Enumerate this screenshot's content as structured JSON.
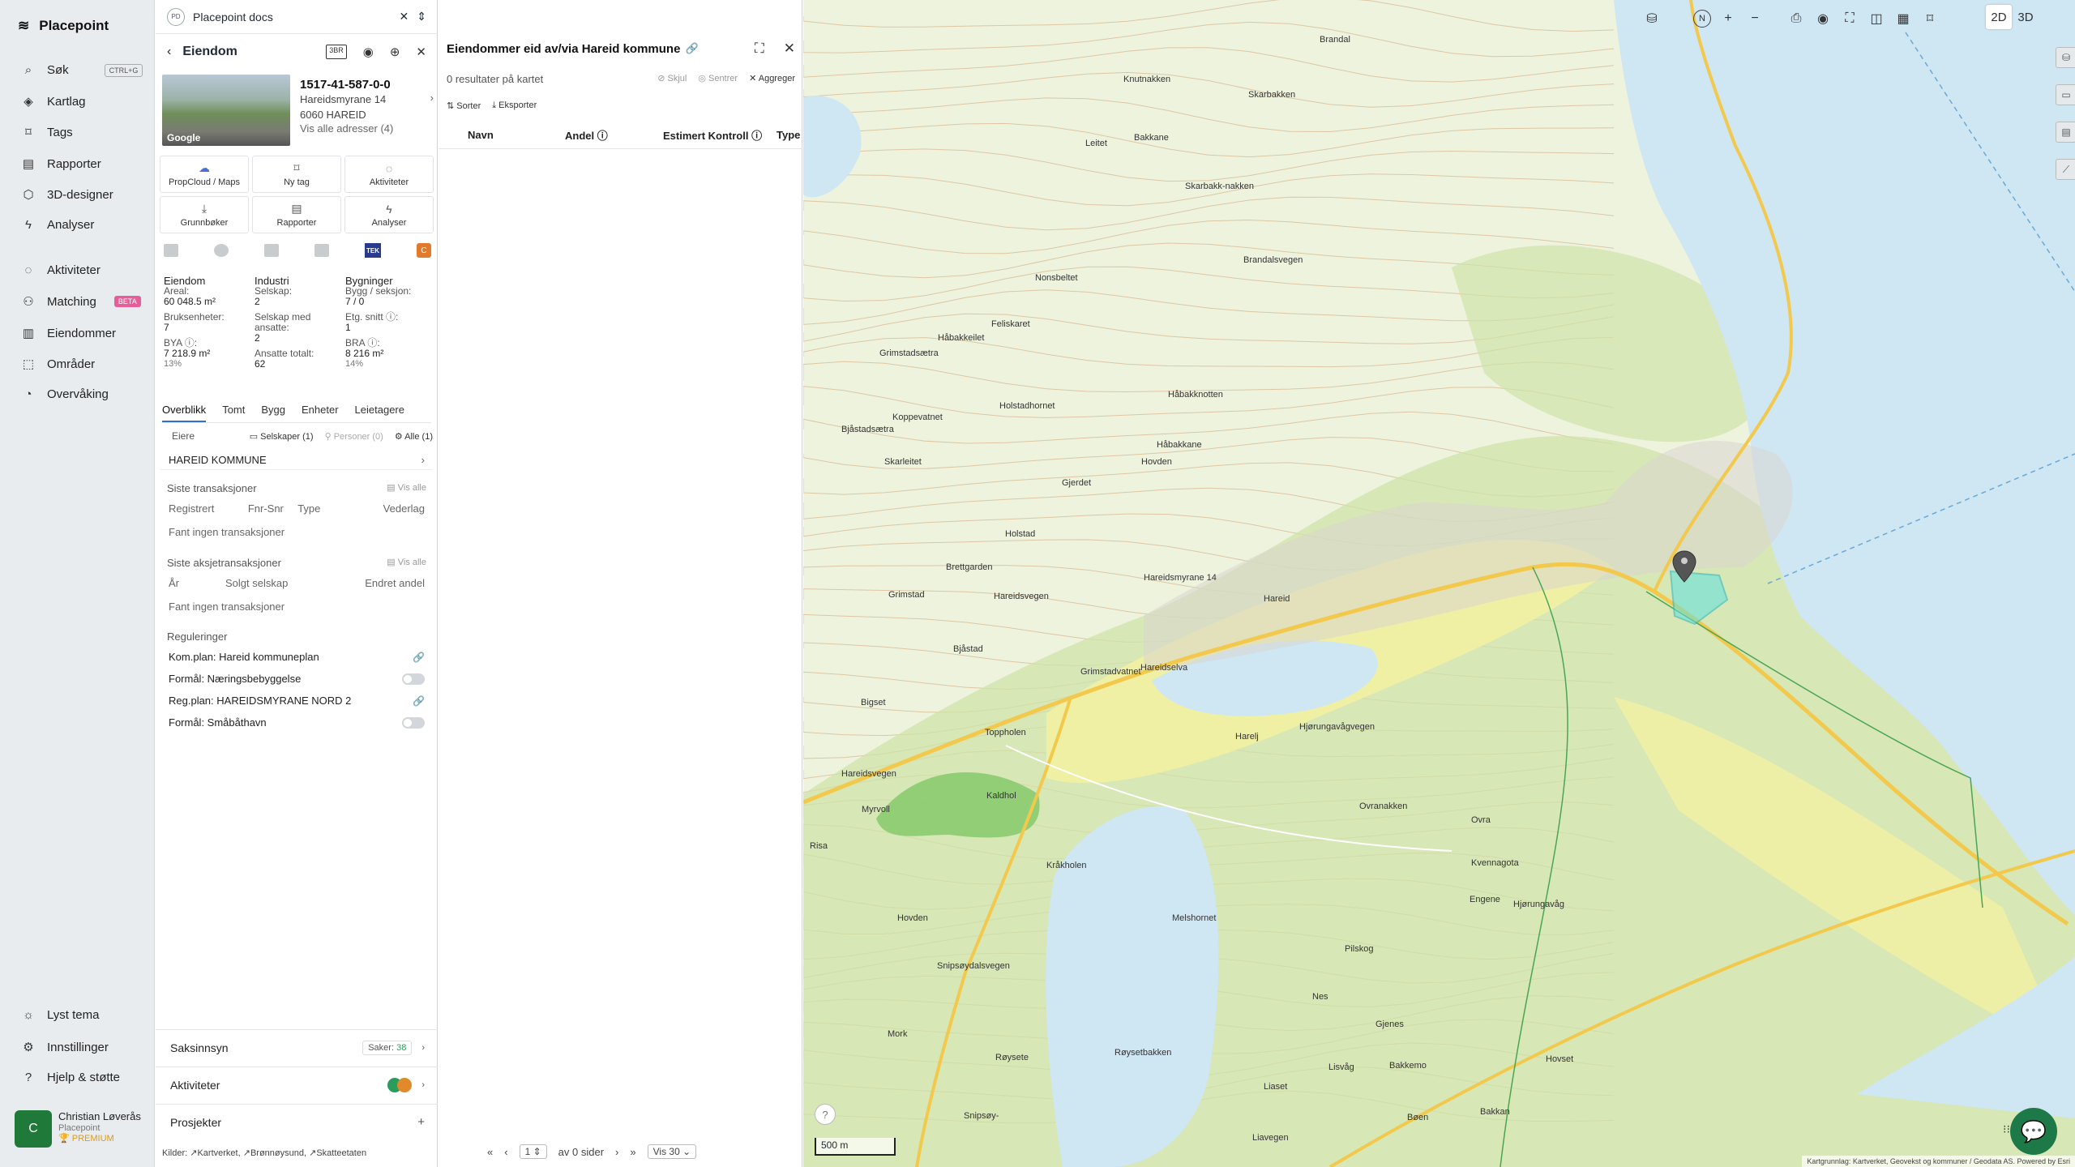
{
  "nav": {
    "brand": "Placepoint",
    "items": [
      {
        "label": "Søk",
        "shortcut": "CTRL+G"
      },
      {
        "label": "Kartlag"
      },
      {
        "label": "Tags"
      },
      {
        "label": "Rapporter"
      },
      {
        "label": "3D-designer"
      },
      {
        "label": "Analyser"
      },
      {
        "label": "Aktiviteter"
      },
      {
        "label": "Matching",
        "badge": "BETA"
      },
      {
        "label": "Eiendommer"
      },
      {
        "label": "Områder"
      },
      {
        "label": "Overvåking"
      }
    ],
    "bottom": [
      {
        "label": "Lyst tema"
      },
      {
        "label": "Innstillinger"
      },
      {
        "label": "Hjelp & støtte"
      }
    ],
    "user": {
      "initial": "C",
      "name": "Christian Løverås",
      "org": "Placepoint",
      "plan": "PREMIUM"
    }
  },
  "docs": {
    "badge": "PD",
    "title": "Placepoint docs"
  },
  "property": {
    "header": "Eiendom",
    "cube_label": "3BR",
    "thumb_label": "Google",
    "id": "1517-41-587-0-0",
    "address1": "Hareidsmyrane 14",
    "address2": "6060 HAREID",
    "all_addresses": "Vis alle adresser (4)",
    "actions": [
      "PropCloud / Maps",
      "Ny tag",
      "Aktiviteter",
      "Grunnbøker",
      "Rapporter",
      "Analyser"
    ],
    "tek": "TEK",
    "cbadge": "C",
    "stats": {
      "eiendom": {
        "head": "Eiendom",
        "areal_l": "Areal:",
        "areal_v": "60 048.5 m²",
        "bruks_l": "Bruksenheter:",
        "bruks_v": "7",
        "bya_l": "BYA ⓘ:",
        "bya_v": "7 218.9 m²",
        "bya_p": "13%"
      },
      "industri": {
        "head": "Industri",
        "sel_l": "Selskap:",
        "sel_v": "2",
        "selans_l": "Selskap med ansatte:",
        "selans_v": "2",
        "ans_l": "Ansatte totalt:",
        "ans_v": "62"
      },
      "bygninger": {
        "head": "Bygninger",
        "bygg_l": "Bygg / seksjon:",
        "bygg_v": "7 / 0",
        "etg_l": "Etg. snitt ⓘ:",
        "etg_v": "1",
        "bra_l": "BRA ⓘ:",
        "bra_v": "8 216 m²",
        "bra_p": "14%"
      }
    },
    "tabs": [
      "Overblikk",
      "Tomt",
      "Bygg",
      "Enheter",
      "Leietagere"
    ],
    "owners": {
      "label": "Eiere",
      "selskaper": "Selskaper (1)",
      "personer": "Personer (0)",
      "alle": "Alle (1)",
      "owner": "HAREID KOMMUNE"
    },
    "transactions": {
      "title": "Siste transaksjoner",
      "view_all": "Vis alle",
      "cols": [
        "Registrert",
        "Fnr-Snr",
        "Type",
        "Vederlag"
      ],
      "empty": "Fant ingen transaksjoner"
    },
    "share_tx": {
      "title": "Siste aksjetransaksjoner",
      "view_all": "Vis alle",
      "cols": [
        "År",
        "Solgt selskap",
        "Endret andel"
      ],
      "empty": "Fant ingen transaksjoner"
    },
    "regulations": {
      "title": "Reguleringer",
      "rows": [
        "Kom.plan: Hareid kommuneplan",
        "Formål: Næringsbebyggelse",
        "Reg.plan: HAREIDSMYRANE NORD 2",
        "Formål: Småbåthavn"
      ]
    },
    "saksinnsyn": {
      "label": "Saksinnsyn",
      "saker_l": "Saker:",
      "saker_v": "38"
    },
    "aktiviteter": {
      "label": "Aktiviteter"
    },
    "prosjekter": {
      "label": "Prosjekter"
    },
    "kilder": {
      "label": "Kilder:",
      "items": [
        "Kartverket,",
        "Brønnøysund,",
        "Skatteetaten"
      ]
    }
  },
  "results": {
    "title": "Eiendommer eid av/via Hareid kommune",
    "count": "0 resultater på kartet",
    "tools": [
      "Skjul",
      "Sentrer",
      "Aggreger"
    ],
    "sort": "Sorter",
    "export": "Eksporter",
    "columns": [
      "Navn",
      "Andel ⓘ",
      "Estimert Kontroll ⓘ",
      "Type"
    ],
    "pager": {
      "page": "1",
      "of": "av 0 sider",
      "per": "Vis 30"
    }
  },
  "map": {
    "mode2d": "2D",
    "mode3d": "3D",
    "north": "N",
    "scale": "500 m",
    "attribution": "Kartgrunnlag: Kartverket, Geovekst og kommuner / Geodata AS. Powered by Esri",
    "places": [
      {
        "name": "Brandal",
        "lx": 0.406,
        "ly": 0.036
      },
      {
        "name": "Knutnakken",
        "lx": 0.252,
        "ly": 0.07
      },
      {
        "name": "Skarbakken",
        "lx": 0.35,
        "ly": 0.083
      },
      {
        "name": "Bakkane",
        "lx": 0.26,
        "ly": 0.12
      },
      {
        "name": "Leitet",
        "lx": 0.222,
        "ly": 0.125
      },
      {
        "name": "Skarbakk-nakken",
        "lx": 0.3,
        "ly": 0.162
      },
      {
        "name": "Brandalsvegen",
        "lx": 0.346,
        "ly": 0.225
      },
      {
        "name": "Nonsbeltet",
        "lx": 0.182,
        "ly": 0.24
      },
      {
        "name": "Feliskaret",
        "lx": 0.148,
        "ly": 0.28
      },
      {
        "name": "Håbakkeilet",
        "lx": 0.106,
        "ly": 0.292
      },
      {
        "name": "Grimstadsætra",
        "lx": 0.06,
        "ly": 0.305
      },
      {
        "name": "Håbakknotten",
        "lx": 0.287,
        "ly": 0.34
      },
      {
        "name": "Holstadhornet",
        "lx": 0.154,
        "ly": 0.35
      },
      {
        "name": "Bjåstadsætra",
        "lx": 0.03,
        "ly": 0.37
      },
      {
        "name": "Koppevatnet",
        "lx": 0.07,
        "ly": 0.36
      },
      {
        "name": "Skarleitet",
        "lx": 0.064,
        "ly": 0.398
      },
      {
        "name": "Håbakkane",
        "lx": 0.278,
        "ly": 0.383
      },
      {
        "name": "Hovden",
        "lx": 0.266,
        "ly": 0.398
      },
      {
        "name": "Gjerdet",
        "lx": 0.203,
        "ly": 0.416
      },
      {
        "name": "Holstad",
        "lx": 0.159,
        "ly": 0.46
      },
      {
        "name": "Brettgarden",
        "lx": 0.112,
        "ly": 0.488
      },
      {
        "name": "Grimstad",
        "lx": 0.067,
        "ly": 0.512
      },
      {
        "name": "Hareid",
        "lx": 0.362,
        "ly": 0.515
      },
      {
        "name": "Hareidsvegen",
        "lx": 0.15,
        "ly": 0.513
      },
      {
        "name": "Bjåstad",
        "lx": 0.118,
        "ly": 0.558
      },
      {
        "name": "Grimstadvatnet",
        "lx": 0.218,
        "ly": 0.578
      },
      {
        "name": "Hareidselva",
        "lx": 0.265,
        "ly": 0.574
      },
      {
        "name": "Bigset",
        "lx": 0.045,
        "ly": 0.604
      },
      {
        "name": "Toppholen",
        "lx": 0.143,
        "ly": 0.63
      },
      {
        "name": "Hjørungavågvegen",
        "lx": 0.39,
        "ly": 0.625
      },
      {
        "name": "Harelj",
        "lx": 0.34,
        "ly": 0.633
      },
      {
        "name": "Hareidsvegen",
        "lx": 0.03,
        "ly": 0.665
      },
      {
        "name": "Myrvoll",
        "lx": 0.046,
        "ly": 0.696
      },
      {
        "name": "Kaldhol",
        "lx": 0.144,
        "ly": 0.684
      },
      {
        "name": "Ovranakken",
        "lx": 0.437,
        "ly": 0.693
      },
      {
        "name": "Ovra",
        "lx": 0.525,
        "ly": 0.705
      },
      {
        "name": "Risa",
        "lx": 0.005,
        "ly": 0.727
      },
      {
        "name": "Kråkholen",
        "lx": 0.191,
        "ly": 0.744
      },
      {
        "name": "Kvennagota",
        "lx": 0.525,
        "ly": 0.742
      },
      {
        "name": "Engene",
        "lx": 0.524,
        "ly": 0.773
      },
      {
        "name": "Hjørungavåg",
        "lx": 0.558,
        "ly": 0.777
      },
      {
        "name": "Hovden",
        "lx": 0.074,
        "ly": 0.789
      },
      {
        "name": "Melshornet",
        "lx": 0.29,
        "ly": 0.789
      },
      {
        "name": "Pilskog",
        "lx": 0.426,
        "ly": 0.815
      },
      {
        "name": "Snipsøydalsvegen",
        "lx": 0.105,
        "ly": 0.83
      },
      {
        "name": "Nes",
        "lx": 0.4,
        "ly": 0.856
      },
      {
        "name": "Mork",
        "lx": 0.066,
        "ly": 0.888
      },
      {
        "name": "Gjenes",
        "lx": 0.45,
        "ly": 0.88
      },
      {
        "name": "Røysete",
        "lx": 0.151,
        "ly": 0.908
      },
      {
        "name": "Røysetbakken",
        "lx": 0.245,
        "ly": 0.904
      },
      {
        "name": "Lisvåg",
        "lx": 0.413,
        "ly": 0.917
      },
      {
        "name": "Bakkemo",
        "lx": 0.461,
        "ly": 0.915
      },
      {
        "name": "Hovset",
        "lx": 0.584,
        "ly": 0.91
      },
      {
        "name": "Liaset",
        "lx": 0.362,
        "ly": 0.933
      },
      {
        "name": "Bakkan",
        "lx": 0.532,
        "ly": 0.955
      },
      {
        "name": "Snipsøy-",
        "lx": 0.126,
        "ly": 0.958
      },
      {
        "name": "Liavegen",
        "lx": 0.353,
        "ly": 0.977
      },
      {
        "name": "Bøen",
        "lx": 0.475,
        "ly": 0.96
      },
      {
        "name": "Hareidsmyrane 14",
        "lx": 0.268,
        "ly": 0.497
      }
    ]
  }
}
